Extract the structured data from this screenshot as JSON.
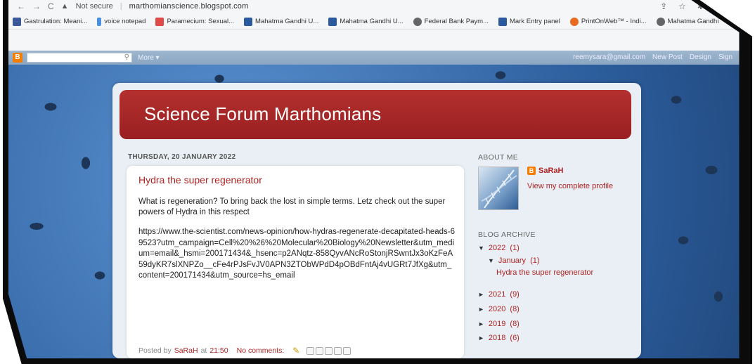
{
  "browser": {
    "url_status": "Not secure",
    "url": "marthomianscience.blogspot.com",
    "bookmarks": [
      {
        "label": "Gastrulation: Meani...",
        "color": "#3b5998"
      },
      {
        "label": "voice notepad",
        "color": "#4a90e2"
      },
      {
        "label": "Paramecium: Sexual...",
        "color": "#e24a4a"
      },
      {
        "label": "Mahatma Gandhi U...",
        "color": "#2b5a9e"
      },
      {
        "label": "Mahatma Gandhi U...",
        "color": "#2b5a9e"
      },
      {
        "label": "Federal Bank Paym...",
        "color": "#666666"
      },
      {
        "label": "Mark Entry panel",
        "color": "#2b5a9e"
      },
      {
        "label": "PrintOnWeb™ - Indi...",
        "color": "#e86b1f"
      },
      {
        "label": "Mahatma Gandhi",
        "color": "#666666"
      }
    ]
  },
  "blogger_bar": {
    "more": "More ▾",
    "email": "reemysara@gmail.com",
    "new_post": "New Post",
    "design": "Design",
    "sign": "Sign"
  },
  "blog": {
    "title": "Science Forum Marthomians"
  },
  "post": {
    "date": "THURSDAY, 20 JANUARY 2022",
    "title": "Hydra the super regenerator",
    "body": "What is regeneration? To bring back the lost in simple terms. Letz check out the super powers of Hydra in this respect",
    "link": "https://www.the-scientist.com/news-opinion/how-hydras-regenerate-decapitated-heads-69523?utm_campaign=Cell%20%26%20Molecular%20Biology%20Newsletter&utm_medium=email&_hsmi=200171434&_hsenc=p2ANqtz-858QyvANcRoStonjRSwntJx3oKzFeA59dyKR7slXNPZo__cFe4rPJsFvJV0APN3ZTObWPdD4pOBdFntAj4vUGRt7JfXg&utm_content=200171434&utm_source=hs_email",
    "posted_by": "Posted by",
    "author": "SaRaH",
    "at": "at",
    "time": "21:50",
    "comments": "No comments:"
  },
  "sidebar": {
    "about_heading": "ABOUT ME",
    "profile_name": "SaRaH",
    "profile_link": "View my complete profile",
    "archive_heading": "BLOG ARCHIVE",
    "archive": [
      {
        "year": "2022",
        "count": "(1)",
        "expanded": true
      },
      {
        "month": "January",
        "count": "(1)"
      },
      {
        "post": "Hydra the super regenerator"
      },
      {
        "year": "2021",
        "count": "(9)"
      },
      {
        "year": "2020",
        "count": "(8)"
      },
      {
        "year": "2019",
        "count": "(8)"
      },
      {
        "year": "2018",
        "count": "(6)"
      }
    ]
  }
}
